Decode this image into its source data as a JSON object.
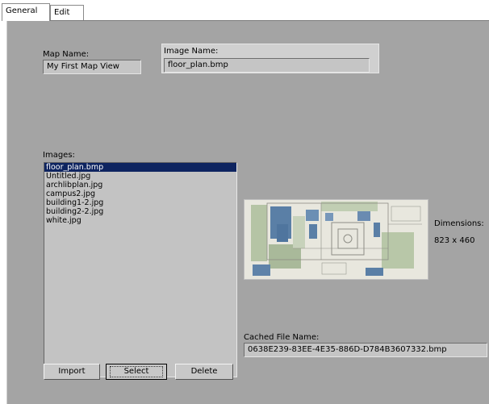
{
  "tabs": [
    {
      "label": "General"
    },
    {
      "label": "Edit"
    }
  ],
  "map_name": {
    "label": "Map Name:",
    "value": "My First Map View"
  },
  "image_name": {
    "label": "Image Name:",
    "value": "floor_plan.bmp"
  },
  "images": {
    "label": "Images:",
    "items": [
      "floor_plan.bmp",
      "Untitled.jpg",
      "archlibplan.jpg",
      "campus2.jpg",
      "building1-2.jpg",
      "building2-2.jpg",
      "white.jpg"
    ],
    "selected_index": 0
  },
  "dimensions": {
    "label": "Dimensions:",
    "value": "823 x 460"
  },
  "cached_file": {
    "label": "Cached File Name:",
    "value": "0638E239-83EE-4E35-886D-D784B3607332.bmp"
  },
  "buttons": {
    "import": "Import",
    "select": "Select",
    "delete": "Delete"
  },
  "colors": {
    "panel_bg": "#a4a4a4",
    "selection": "#0e2460",
    "field_bg": "#c5c5c5"
  }
}
